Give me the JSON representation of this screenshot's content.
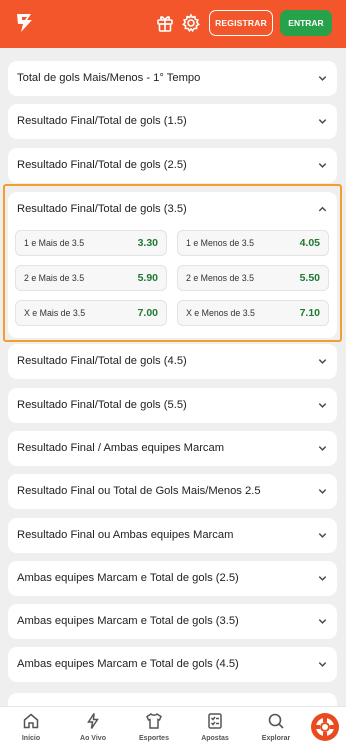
{
  "header": {
    "register_label": "REGISTRAR",
    "login_label": "ENTRAR",
    "brand_color": "#f2562a"
  },
  "markets": [
    {
      "title": "Total de gols Mais/Menos - 1° Tempo"
    },
    {
      "title": "Resultado Final/Total de gols (1.5)"
    },
    {
      "title": "Resultado Final/Total de gols (2.5)"
    },
    {
      "title": "Resultado Final/Total de gols (3.5)",
      "expanded": true
    },
    {
      "title": "Resultado Final/Total de gols (4.5)"
    },
    {
      "title": "Resultado Final/Total de gols (5.5)"
    },
    {
      "title": "Resultado Final / Ambas equipes Marcam"
    },
    {
      "title": "Resultado Final ou Total de Gols Mais/Menos 2.5"
    },
    {
      "title": "Resultado Final ou Ambas equipes Marcam"
    },
    {
      "title": "Ambas equipes Marcam e Total de gols (2.5)"
    },
    {
      "title": "Ambas equipes Marcam e Total de gols (3.5)"
    },
    {
      "title": "Ambas equipes Marcam e Total de gols (4.5)"
    }
  ],
  "expanded_odds": [
    {
      "label": "1 e Mais de 3.5",
      "value": "3.30"
    },
    {
      "label": "1 e Menos de 3.5",
      "value": "4.05"
    },
    {
      "label": "2 e Mais de 3.5",
      "value": "5.90"
    },
    {
      "label": "2 e Menos de 3.5",
      "value": "5.50"
    },
    {
      "label": "X e Mais de 3.5",
      "value": "7.00"
    },
    {
      "label": "X e Menos de 3.5",
      "value": "7.10"
    }
  ],
  "tabbar": {
    "items": [
      {
        "label": "Início",
        "icon": "home-icon"
      },
      {
        "label": "Ao Vivo",
        "icon": "lightning-icon"
      },
      {
        "label": "Esportes",
        "icon": "jersey-icon"
      },
      {
        "label": "Apostas",
        "icon": "betslip-icon"
      },
      {
        "label": "Explorar",
        "icon": "search-icon"
      }
    ]
  }
}
